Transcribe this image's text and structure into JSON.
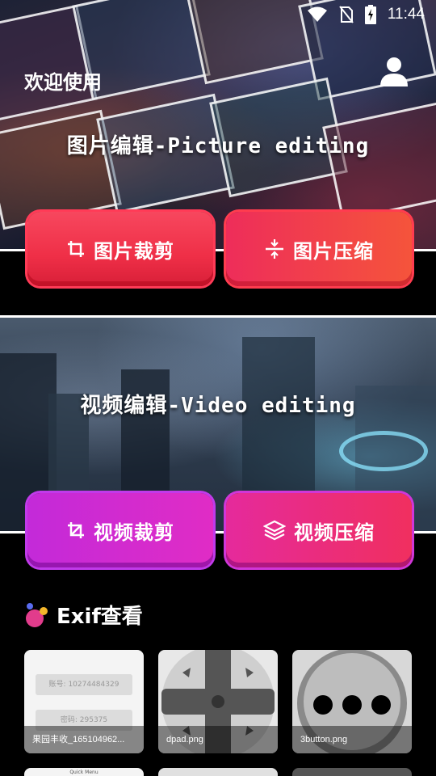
{
  "status_bar": {
    "time": "11:44"
  },
  "header": {
    "welcome": "欢迎使用"
  },
  "picture_section": {
    "title": "图片编辑-Picture editing",
    "crop_label": "图片裁剪",
    "compress_label": "图片压缩"
  },
  "video_section": {
    "title": "视频编辑-Video editing",
    "crop_label": "视频裁剪",
    "compress_label": "视频压缩"
  },
  "exif": {
    "title": "Exif查看",
    "items": [
      {
        "name": "果园丰收_165104962...",
        "field1": "账号: 10274484329",
        "field2": "密码: 295375"
      },
      {
        "name": "dpad.png"
      },
      {
        "name": "3button.png"
      }
    ],
    "partial_item": "Quick Menu"
  },
  "colors": {
    "accent_red": "#ef2f47",
    "accent_purple": "#c32ad9"
  }
}
